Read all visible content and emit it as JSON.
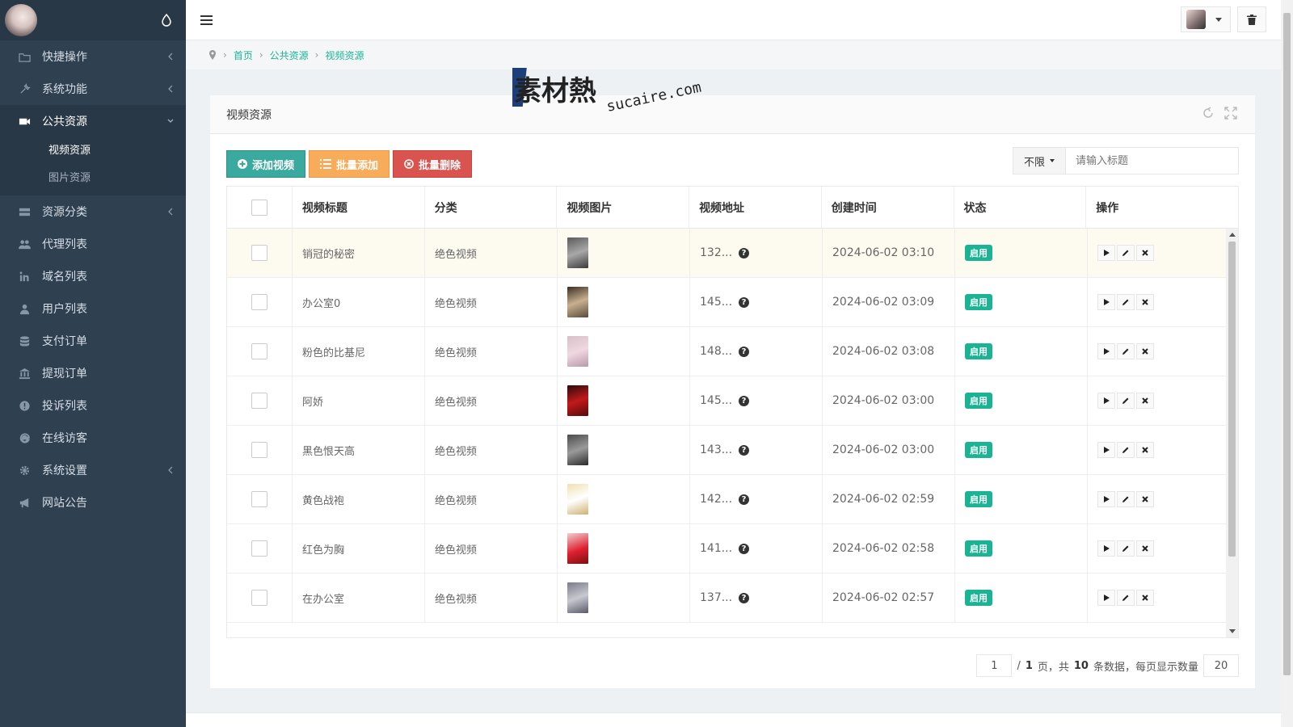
{
  "sidebar": {
    "items": [
      {
        "label": "快捷操作",
        "icon": "folder-icon",
        "has_children": true
      },
      {
        "label": "系统功能",
        "icon": "wrench-icon",
        "has_children": true
      },
      {
        "label": "公共资源",
        "icon": "video-camera-icon",
        "has_children": true,
        "active": true,
        "children": [
          {
            "label": "视频资源",
            "current": true
          },
          {
            "label": "图片资源"
          }
        ]
      },
      {
        "label": "资源分类",
        "icon": "list-icon",
        "has_children": true
      },
      {
        "label": "代理列表",
        "icon": "users-icon"
      },
      {
        "label": "域名列表",
        "icon": "linkedin-icon"
      },
      {
        "label": "用户列表",
        "icon": "user-icon"
      },
      {
        "label": "支付订单",
        "icon": "database-icon"
      },
      {
        "label": "提现订单",
        "icon": "bank-icon"
      },
      {
        "label": "投诉列表",
        "icon": "alert-circle-icon"
      },
      {
        "label": "在线访客",
        "icon": "ie-icon"
      },
      {
        "label": "系统设置",
        "icon": "gear-icon",
        "has_children": true
      },
      {
        "label": "网站公告",
        "icon": "bullhorn-icon"
      }
    ]
  },
  "breadcrumb": [
    "首页",
    "公共资源",
    "视频资源"
  ],
  "panel": {
    "title": "视频资源"
  },
  "watermark": {
    "brand": "素材熱",
    "domain": "sucaire.com"
  },
  "toolbar": {
    "add_label": "添加视频",
    "batch_label": "批量添加",
    "delete_label": "批量删除"
  },
  "search": {
    "filter_label": "不限",
    "placeholder": "请输入标题"
  },
  "table": {
    "headers": [
      "视频标题",
      "分类",
      "视频图片",
      "视频地址",
      "创建时间",
      "状态",
      "操作"
    ],
    "rows": [
      {
        "title": "销冠的秘密",
        "category": "绝色视频",
        "url": "132...",
        "time": "2024-06-02 03:10",
        "status": "启用"
      },
      {
        "title": "办公室0",
        "category": "绝色视频",
        "url": "145...",
        "time": "2024-06-02 03:09",
        "status": "启用"
      },
      {
        "title": "粉色的比基尼",
        "category": "绝色视频",
        "url": "148...",
        "time": "2024-06-02 03:08",
        "status": "启用"
      },
      {
        "title": "阿娇",
        "category": "绝色视频",
        "url": "145...",
        "time": "2024-06-02 03:00",
        "status": "启用"
      },
      {
        "title": "黑色恨天高",
        "category": "绝色视频",
        "url": "143...",
        "time": "2024-06-02 03:00",
        "status": "启用"
      },
      {
        "title": "黄色战袍",
        "category": "绝色视频",
        "url": "142...",
        "time": "2024-06-02 02:59",
        "status": "启用"
      },
      {
        "title": "红色为胸",
        "category": "绝色视频",
        "url": "141...",
        "time": "2024-06-02 02:58",
        "status": "启用"
      },
      {
        "title": "在办公室",
        "category": "绝色视频",
        "url": "137...",
        "time": "2024-06-02 02:57",
        "status": "启用"
      }
    ]
  },
  "pagination": {
    "current": "1",
    "total_pages": "1",
    "total_records": "10",
    "per_page": "20",
    "sep_text": "/",
    "page_unit": "页，共",
    "records_unit": "条数据，每页显示数量"
  },
  "colors": {
    "sidebar": "#2f4050",
    "accent": "#1ab394",
    "add": "#3aa99f",
    "batch": "#f8ac59",
    "delete": "#d9534f"
  }
}
